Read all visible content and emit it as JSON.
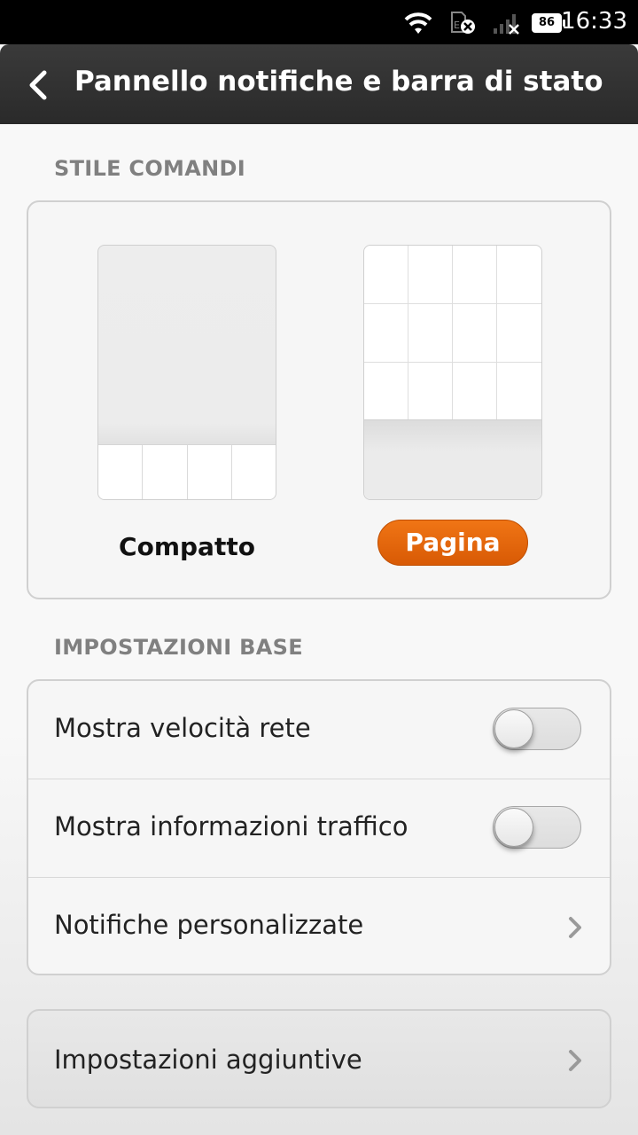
{
  "status_bar": {
    "time": "16:33",
    "battery": "86",
    "icons": [
      "wifi-icon",
      "sim-disabled-icon",
      "signal-no-service-icon",
      "battery-icon"
    ]
  },
  "header": {
    "title": "Pannello notifiche e barra di stato",
    "back_icon": "chevron-left-icon"
  },
  "control_style": {
    "section_title": "STILE COMANDI",
    "options": [
      {
        "label": "Compatto",
        "selected": false
      },
      {
        "label": "Pagina",
        "selected": true
      }
    ],
    "accent_color": "#e8650b"
  },
  "basic_settings": {
    "section_title": "IMPOSTAZIONI BASE",
    "items": [
      {
        "label": "Mostra velocità rete",
        "type": "toggle",
        "on": false
      },
      {
        "label": "Mostra informazioni traffico",
        "type": "toggle",
        "on": false
      },
      {
        "label": "Notifiche personalizzate",
        "type": "link",
        "icon": "chevron-right-icon"
      }
    ]
  },
  "extra": {
    "label": "Impostazioni aggiuntive",
    "icon": "chevron-right-icon"
  }
}
